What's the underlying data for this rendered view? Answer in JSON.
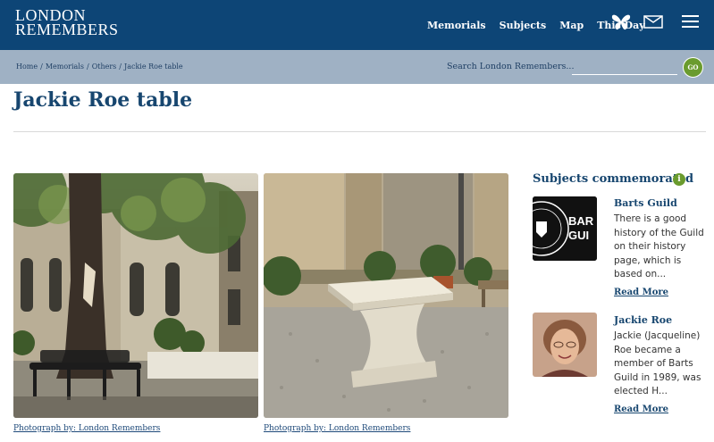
{
  "header": {
    "logo_line1": "LONDON",
    "logo_line2": "REMEMBERS",
    "nav": [
      "Memorials",
      "Subjects",
      "Map",
      "This Day"
    ],
    "icons": [
      "butterfly-icon",
      "envelope-icon",
      "hamburger-menu-icon"
    ]
  },
  "breadcrumb": {
    "items": [
      "Home",
      "Memorials",
      "Others",
      "Jackie Roe table"
    ],
    "separator": "/"
  },
  "search": {
    "label": "Search London Remembers...",
    "value": "",
    "go_label": "GO"
  },
  "page": {
    "title": "Jackie Roe table"
  },
  "photos": [
    {
      "caption": "Photograph by: London Remembers",
      "subject": "courtyard-with-tree-and-bench"
    },
    {
      "caption": "Photograph by: London Remembers",
      "subject": "stone-pedestal-table-on-gravel"
    }
  ],
  "sidebar": {
    "title": "Subjects commemorated",
    "info_icon": "i",
    "subjects": [
      {
        "name": "Barts Guild",
        "description": "There is a good history of the Guild on their history page, which is based on...",
        "read_more": "Read More",
        "thumb_text": [
          "BAR",
          "GUI"
        ]
      },
      {
        "name": "Jackie Roe",
        "description": "Jackie (Jacqueline) Roe became a member of Barts Guild in 1989, was elected H...",
        "read_more": "Read More"
      }
    ]
  },
  "colors": {
    "header_bg": "#0d4576",
    "crumb_bg": "#9fb1c4",
    "accent_green": "#6a9b2e",
    "title_blue": "#17466f"
  }
}
